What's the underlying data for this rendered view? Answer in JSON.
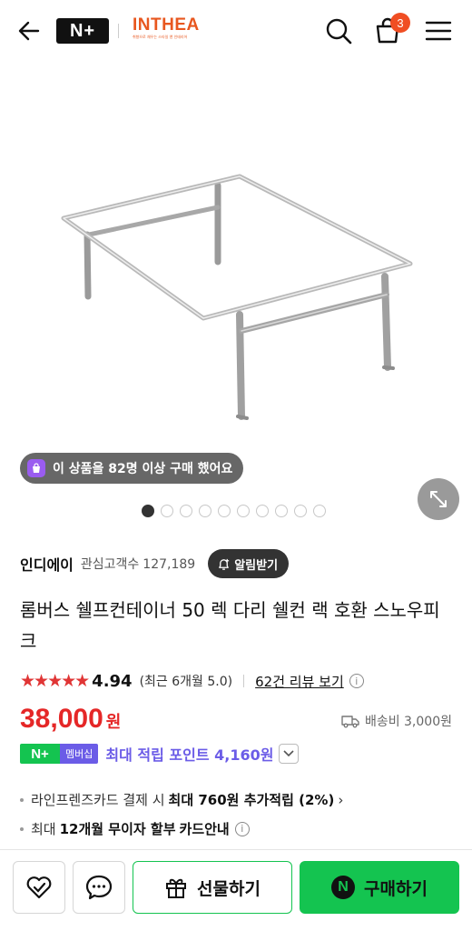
{
  "header": {
    "logo": "N+",
    "brand_name": "INTHEA",
    "brand_tagline": "취향으로 채우는 스타일 앤 인테리어",
    "cart_count": "3"
  },
  "gallery": {
    "buy_count_text": "이 상품을 82명 이상 구매 했어요",
    "total_images": 10,
    "active_index": 0
  },
  "store": {
    "name": "인디에이",
    "interest_label": "관심고객수",
    "interest_count": "127,189",
    "notify_label": "알림받기"
  },
  "product": {
    "title": "롬버스 쉘프컨테이너 50 렉 다리 쉘컨 랙 호환 스노우피크"
  },
  "rating": {
    "stars": "★★★★★",
    "score": "4.94",
    "recent": "(최근 6개월 5.0)",
    "reviews_label": "62건 리뷰 보기"
  },
  "price": {
    "amount": "38,000",
    "currency": "원",
    "shipping": "배송비 3,000원"
  },
  "membership": {
    "logo": "N+",
    "badge": "멤버십",
    "text": "최대 적립 포인트 4,160원"
  },
  "benefits": [
    {
      "prefix": "라인프렌즈카드 결제 시",
      "bold": "최대 760원 추가적립 (2%)",
      "suffix": "›"
    },
    {
      "prefix": "최대",
      "bold": "12개월 무이자 할부",
      "suffix": "카드안내"
    }
  ],
  "bottom_bar": {
    "gift_label": "선물하기",
    "buy_label": "구매하기",
    "buy_icon": "N"
  },
  "colors": {
    "accent_green": "#14c450",
    "price_red": "#e52727",
    "member_purple": "#6b5ce7",
    "brand_orange": "#e8571f"
  }
}
